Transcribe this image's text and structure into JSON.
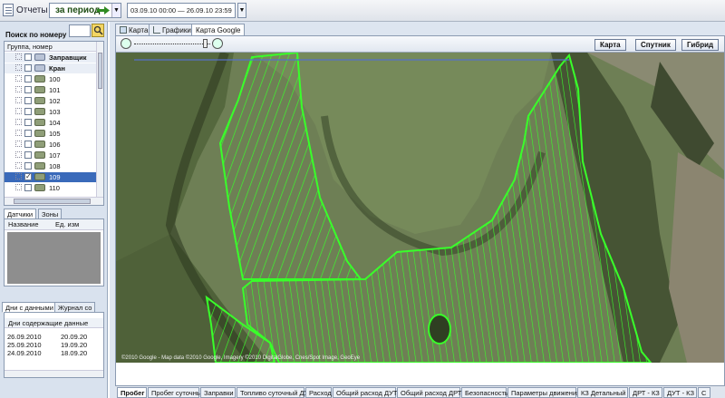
{
  "toolbar": {
    "reports_label": "Отчеты",
    "period_label": "за период",
    "date_range": "03.09.10 00:00 — 26.09.10 23:59"
  },
  "left": {
    "search_label": "Поиск по номеру",
    "tree_header": "Группа, номер",
    "tree_items": [
      {
        "label": "Заправщик",
        "kind": "group",
        "checked": false
      },
      {
        "label": "Кран",
        "kind": "group",
        "checked": false
      },
      {
        "label": "100",
        "kind": "vehicle",
        "checked": false
      },
      {
        "label": "101",
        "kind": "vehicle",
        "checked": false
      },
      {
        "label": "102",
        "kind": "vehicle",
        "checked": false
      },
      {
        "label": "103",
        "kind": "vehicle",
        "checked": false
      },
      {
        "label": "104",
        "kind": "vehicle",
        "checked": false
      },
      {
        "label": "105",
        "kind": "vehicle",
        "checked": false
      },
      {
        "label": "106",
        "kind": "vehicle",
        "checked": false
      },
      {
        "label": "107",
        "kind": "vehicle",
        "checked": false
      },
      {
        "label": "108",
        "kind": "vehicle",
        "checked": false
      },
      {
        "label": "109",
        "kind": "vehicle",
        "checked": true,
        "selected": true
      },
      {
        "label": "110",
        "kind": "vehicle",
        "checked": false
      }
    ],
    "sensors_tabs": [
      "Датчики",
      "Зоны"
    ],
    "sensors_columns": [
      "Название",
      "Ед. изм"
    ],
    "days_tabs": [
      "Дни с данными",
      "Журнал со"
    ],
    "days_header": "Дни содержащие данные",
    "days_rows": [
      [
        "26.09.2010",
        "20.09.20"
      ],
      [
        "25.09.2010",
        "19.09.20"
      ],
      [
        "24.09.2010",
        "18.09.20"
      ]
    ]
  },
  "main": {
    "tabs": [
      "Карта",
      "Графики",
      "Карта Google"
    ],
    "active_tab": 2,
    "map_types": [
      "Карта",
      "Спутник",
      "Гибрид"
    ],
    "copyright": "©2010 Google - Map data ©2010 Google, Imagery ©2010 DigitalGlobe, Cnes/Spot Image, GeoEye",
    "bottom_tabs": [
      "Пробег",
      "Пробег суточный",
      "Заправки",
      "Топливо суточный ДУТ",
      "Расход",
      "Общий расход ДУТ",
      "Общий расход ДРТ",
      "Безопасность",
      "Параметры движения",
      "КЗ Детальный",
      "ДРТ - КЗ",
      "ДУТ - КЗ",
      "С"
    ],
    "active_bottom_tab": 0
  },
  "colors": {
    "track": "#39ff2a",
    "selection": "#3a6aba",
    "chrome": "#dde5f0"
  }
}
